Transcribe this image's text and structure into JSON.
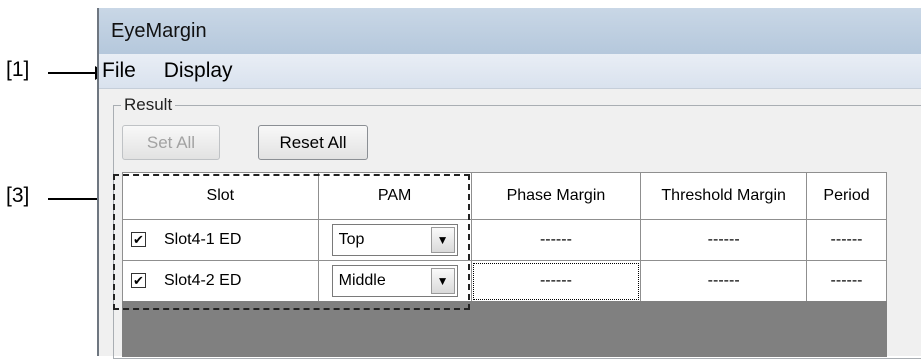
{
  "annotations": {
    "menu_callout": "[1]",
    "grid_callout": "[3]"
  },
  "window": {
    "title": "EyeMargin"
  },
  "menu": {
    "items": [
      "File",
      "Display"
    ]
  },
  "result": {
    "group_label": "Result",
    "set_all_label": "Set All",
    "reset_all_label": "Reset All",
    "columns": [
      "Slot",
      "PAM",
      "Phase Margin",
      "Threshold Margin",
      "Period"
    ],
    "rows": [
      {
        "checked": true,
        "slot": "Slot4-1 ED",
        "pam": "Top",
        "phase_margin": "------",
        "threshold_margin": "------",
        "period": "------"
      },
      {
        "checked": true,
        "slot": "Slot4-2 ED",
        "pam": "Middle",
        "phase_margin": "------",
        "threshold_margin": "------",
        "period": "------"
      }
    ]
  }
}
